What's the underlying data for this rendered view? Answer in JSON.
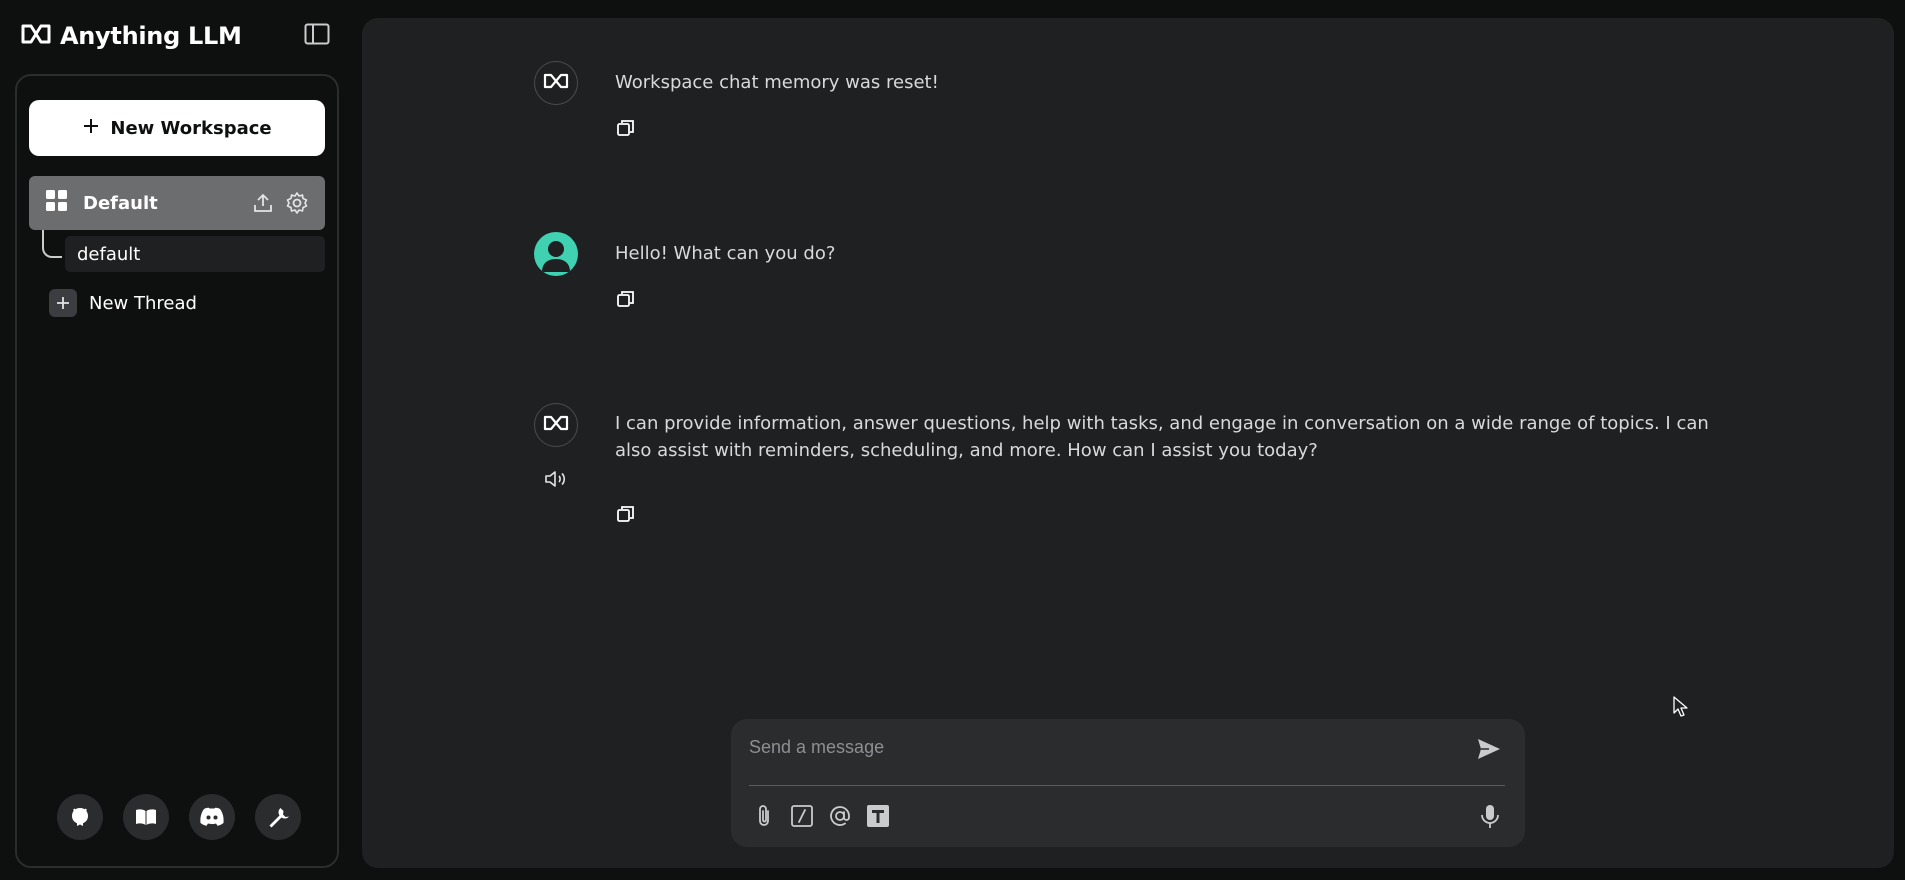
{
  "app": {
    "title": "Anything LLM"
  },
  "sidebar": {
    "new_workspace_label": "New Workspace",
    "workspace": {
      "label": "Default",
      "threads": [
        {
          "label": "default"
        }
      ]
    },
    "new_thread_label": "New Thread",
    "footer_icons": [
      "github-icon",
      "book-icon",
      "discord-icon",
      "wrench-icon"
    ]
  },
  "chat": {
    "messages": [
      {
        "role": "assistant",
        "text": "Workspace chat memory was reset!"
      },
      {
        "role": "user",
        "text": "Hello! What can you do?"
      },
      {
        "role": "assistant",
        "text": "I can provide information, answer questions, help with tasks, and engage in conversation on a wide range of topics. I can also assist with reminders, scheduling, and more. How can I assist you today?"
      }
    ]
  },
  "composer": {
    "placeholder": "Send a message",
    "value": ""
  },
  "colors": {
    "background": "#0e0f0f",
    "panel": "#1f2022",
    "accent_user_avatar": "#3fd1b2",
    "workspace_active": "#6b6d6f"
  }
}
